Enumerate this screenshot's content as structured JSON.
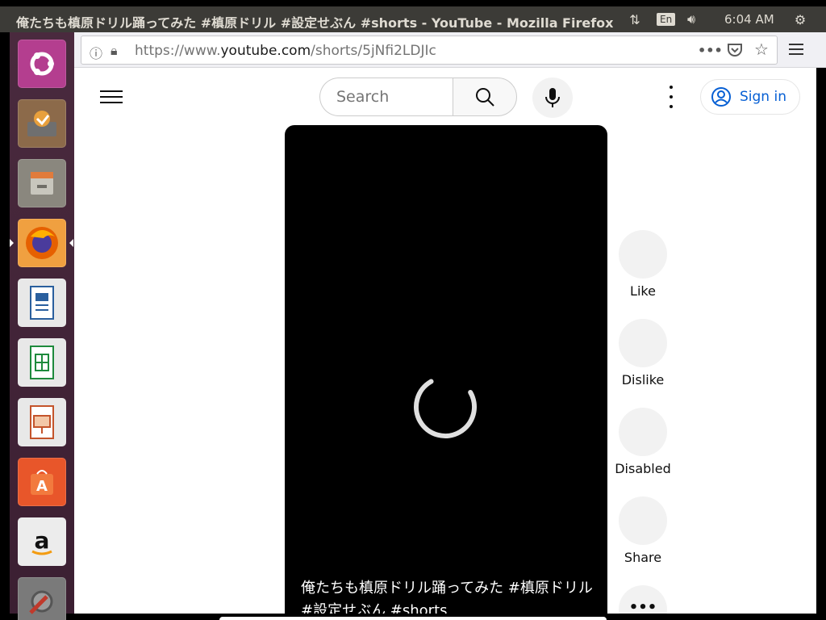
{
  "panel": {
    "window_title": "俺たちも槙原ドリル踊ってみた #槙原ドリル #設定せぶん #shorts - YouTube - Mozilla Firefox",
    "lang": "En",
    "clock": "6:04 AM"
  },
  "launcher": {
    "items": [
      {
        "name": "ubuntu-dash",
        "color": "#b43e8f"
      },
      {
        "name": "software-updater",
        "color": "#9c6a3c"
      },
      {
        "name": "files",
        "color": "#7c7a72"
      },
      {
        "name": "firefox",
        "color": "#e66000"
      },
      {
        "name": "libreoffice-writer",
        "color": "#2a5f9e"
      },
      {
        "name": "libreoffice-calc",
        "color": "#1e8a3c"
      },
      {
        "name": "libreoffice-impress",
        "color": "#c4542b"
      },
      {
        "name": "ubuntu-software",
        "color": "#e8562a"
      },
      {
        "name": "amazon",
        "color": "#d8d8d8"
      },
      {
        "name": "system-settings",
        "color": "#b03a2e"
      }
    ]
  },
  "browser": {
    "url_prefix": "https://www.",
    "url_domain": "youtube.com",
    "url_path": "/shorts/5jNfi2LDJIc"
  },
  "youtube": {
    "search_placeholder": "Search",
    "sign_in": "Sign in",
    "short_title": "俺たちも槙原ドリル踊ってみた #槙原ドリル #設定せぶん #shorts",
    "actions": [
      {
        "key": "like",
        "label": "Like"
      },
      {
        "key": "dislike",
        "label": "Dislike"
      },
      {
        "key": "comments",
        "label": "Disabled"
      },
      {
        "key": "share",
        "label": "Share"
      }
    ]
  },
  "colors": {
    "accent": "#065fd4",
    "panel": "#3c3b37",
    "launcher": "#4a2a3e"
  }
}
